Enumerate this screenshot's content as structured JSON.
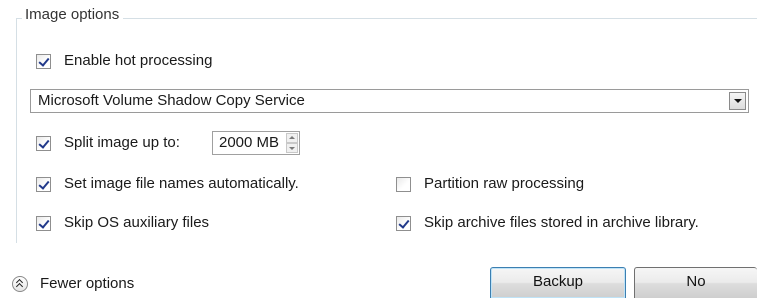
{
  "group": {
    "title": "Image options"
  },
  "options": {
    "hot_processing": {
      "label": "Enable hot processing",
      "checked": true
    },
    "split_image": {
      "label": "Split image up to:",
      "checked": true
    },
    "auto_names": {
      "label": "Set image file names automatically.",
      "checked": true
    },
    "skip_os": {
      "label": "Skip OS auxiliary files",
      "checked": true
    },
    "partition_raw": {
      "label": "Partition raw processing",
      "checked": false
    },
    "skip_archive": {
      "label": "Skip archive files stored in archive library.",
      "checked": true
    }
  },
  "shadow_copy_select": {
    "value": "Microsoft Volume Shadow Copy Service"
  },
  "split_size": {
    "value": "2000 MB"
  },
  "footer": {
    "fewer_options_label": "Fewer options",
    "backup_label": "Backup",
    "no_label": "No"
  },
  "icons": {
    "fewer": "double-chevron-up-icon",
    "dropdown": "chevron-down-icon",
    "spin": "spin-up-down-icon"
  }
}
